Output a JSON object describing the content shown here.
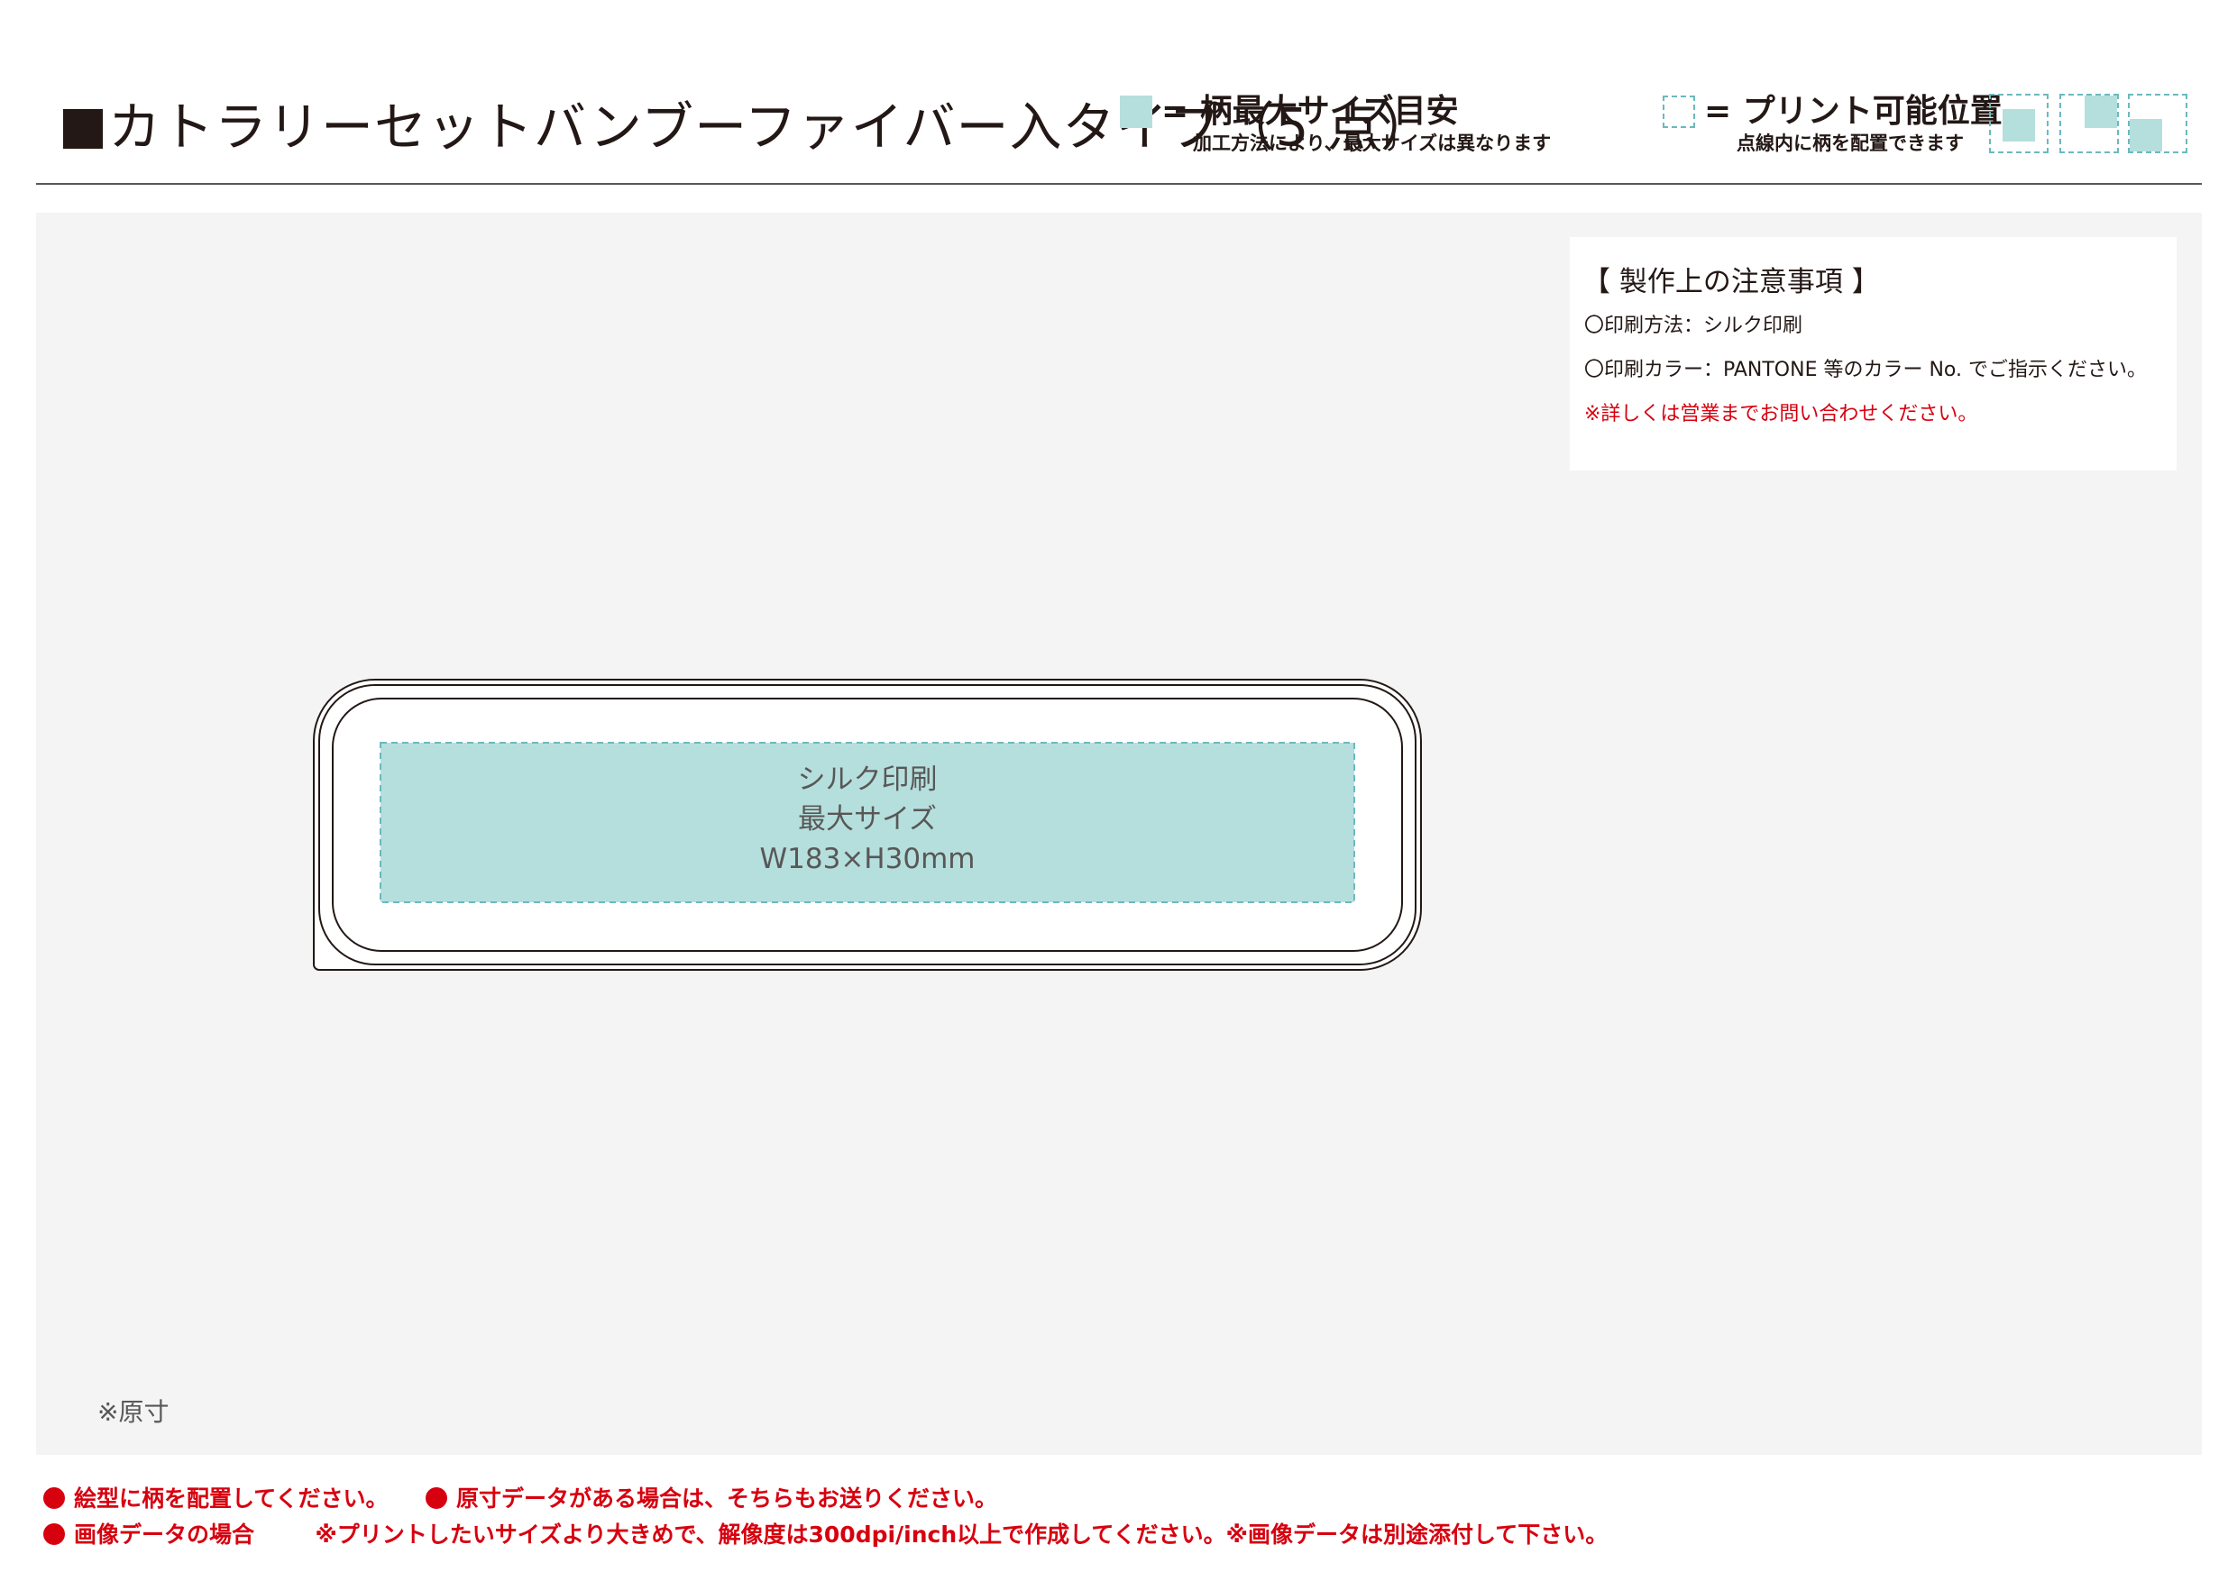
{
  "header": {
    "title": "カトラリーセットバンブーファイバー入タイプ（5 点）",
    "legend_max": {
      "label": "= 柄最大サイズ目安",
      "sub": "加工方法により、最大サイズは異なります",
      "color": "#b5dfdd"
    },
    "legend_pos": {
      "label": "= プリント可能位置",
      "sub": "点線内に柄を配置できます",
      "color": "#6cb9bd"
    }
  },
  "notes": {
    "heading": "【 製作上の注意事項 】",
    "method": "〇印刷方法：シルク印刷",
    "color": "〇印刷カラー：PANTONE 等のカラー No. でご指示ください。",
    "contact": "※詳しくは営業までお問い合わせください。"
  },
  "print_area": {
    "line1": "シルク印刷",
    "line2": "最大サイズ",
    "line3": "W183×H30mm"
  },
  "scale_note": "※原寸",
  "footer": {
    "line1_a": "絵型に柄を配置してください。",
    "line1_b": "原寸データがある場合は、そちらもお送りください。",
    "line2_a": "画像データの場合",
    "line2_b": "※プリントしたいサイズより大きめで、解像度は300dpi/inch以上で作成してください。※画像データは別途添付して下さい。"
  },
  "colors": {
    "accent_red": "#d7000f",
    "print_area_fill": "#b5dfdd",
    "dash": "#6cb9bd"
  }
}
